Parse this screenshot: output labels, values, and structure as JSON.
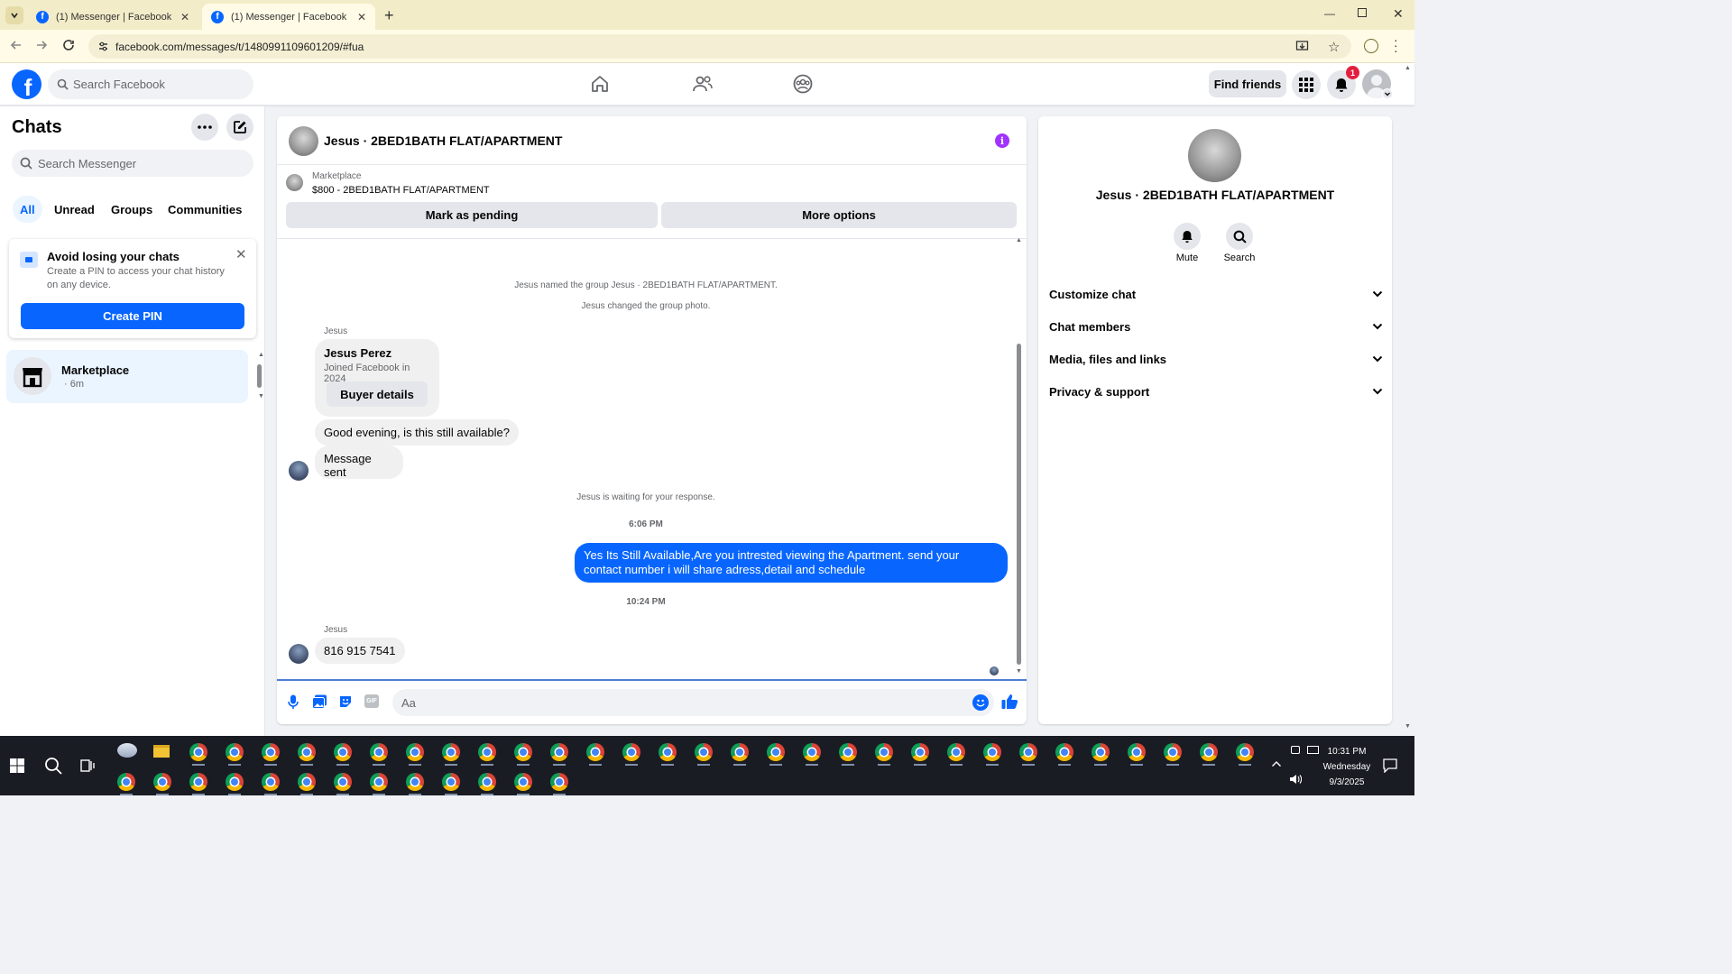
{
  "browser": {
    "tabs": [
      {
        "title": "(1) Messenger | Facebook",
        "active": false
      },
      {
        "title": "(1) Messenger | Facebook",
        "active": true
      }
    ],
    "url": "facebook.com/messages/t/1480991109601209/#fua"
  },
  "header": {
    "search_placeholder": "Search Facebook",
    "find_friends": "Find friends",
    "notification_count": "1"
  },
  "sidebar": {
    "title": "Chats",
    "search_placeholder": "Search Messenger",
    "filters": [
      "All",
      "Unread",
      "Groups",
      "Communities"
    ],
    "pin_card": {
      "title": "Avoid losing your chats",
      "body": "Create a PIN to access your chat history on any device.",
      "button": "Create PIN"
    },
    "chats": [
      {
        "name": "Marketplace",
        "meta": "· 6m"
      }
    ]
  },
  "conversation": {
    "title": "Jesus · 2BED1BATH FLAT/APARTMENT",
    "marketplace_label": "Marketplace",
    "listing": "$800 - 2BED1BATH FLAT/APARTMENT",
    "mark_pending": "Mark as pending",
    "more_options": "More options",
    "system_1": "Jesus named the group Jesus · 2BED1BATH FLAT/APARTMENT.",
    "system_2": "Jesus changed the group photo.",
    "sender_1": "Jesus",
    "profile_name": "Jesus Perez",
    "profile_joined": "Joined Facebook in 2024",
    "buyer_details": "Buyer details",
    "msg_1": "Good evening, is this still available?",
    "msg_2": "Message sent",
    "waiting": "Jesus is waiting for your response.",
    "time_1": "6:06 PM",
    "outgoing": "Yes Its Still Available,Are you intrested viewing the Apartment. send your contact number i will share adress,detail and schedule",
    "time_2": "10:24 PM",
    "sender_2": "Jesus",
    "msg_3": "816 915 7541",
    "composer_placeholder": "Aa"
  },
  "info_panel": {
    "title": "Jesus · 2BED1BATH FLAT/APARTMENT",
    "mute": "Mute",
    "search": "Search",
    "sections": [
      "Customize chat",
      "Chat members",
      "Media, files and links",
      "Privacy & support"
    ]
  },
  "taskbar": {
    "time": "10:31 PM",
    "day": "Wednesday",
    "date": "9/3/2025"
  },
  "colors": {
    "brand": "#0866ff",
    "badge": "#e41e3f",
    "info_icon": "#a033ff"
  }
}
